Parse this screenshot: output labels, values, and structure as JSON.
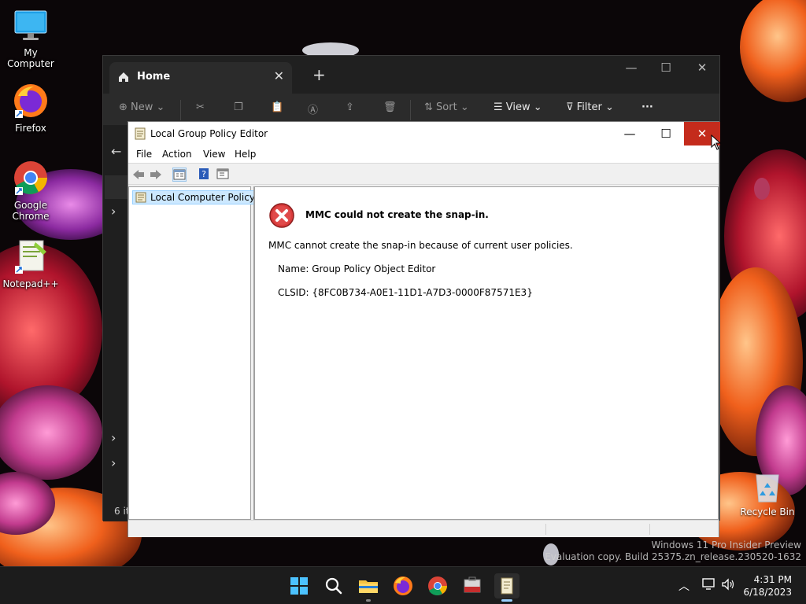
{
  "desktop": {
    "icons": [
      {
        "label": "My Computer",
        "icon": "monitor-icon"
      },
      {
        "label": "Firefox",
        "icon": "firefox-icon"
      },
      {
        "label": "Google Chrome",
        "icon": "chrome-icon"
      },
      {
        "label": "Notepad++",
        "icon": "notepadpp-icon"
      }
    ],
    "recycle_bin": "Recycle Bin"
  },
  "explorer": {
    "tab_title": "Home",
    "toolbar": {
      "new": "New",
      "sort": "Sort",
      "view": "View",
      "filter": "Filter",
      "more": "···"
    },
    "status": "6 it"
  },
  "gpedit": {
    "title": "Local Group Policy Editor",
    "menu": [
      "File",
      "Action",
      "View",
      "Help"
    ],
    "tree_item": "Local Computer Policy",
    "error": {
      "title": "MMC could not create the snap-in.",
      "message": "MMC cannot create the snap-in because of current user policies.",
      "name": "Name: Group Policy Object Editor",
      "clsid": "CLSID: {8FC0B734-A0E1-11D1-A7D3-0000F87571E3}"
    }
  },
  "watermark": {
    "line1": "Windows 11 Pro Insider Preview",
    "line2": "Evaluation copy. Build 25375.zn_release.230520-1632"
  },
  "taskbar": {
    "time": "4:31 PM",
    "date": "6/18/2023"
  },
  "colors": {
    "close_red": "#c42b1c",
    "selection": "#cce8ff",
    "taskbar": "#1c1c1c"
  }
}
